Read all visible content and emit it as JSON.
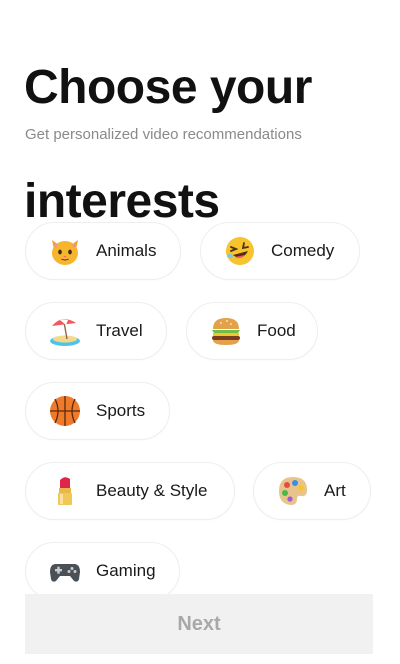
{
  "header": {
    "title_line1": "Choose your",
    "title_line2": "interests",
    "subtitle": "Get personalized video recommendations"
  },
  "interests": [
    {
      "label": "Animals",
      "icon": "cat-face-icon"
    },
    {
      "label": "Comedy",
      "icon": "laughing-face-icon"
    },
    {
      "label": "Travel",
      "icon": "beach-umbrella-icon"
    },
    {
      "label": "Food",
      "icon": "hamburger-icon"
    },
    {
      "label": "Sports",
      "icon": "basketball-icon"
    },
    {
      "label": "Beauty & Style",
      "icon": "lipstick-icon"
    },
    {
      "label": "Art",
      "icon": "palette-icon"
    },
    {
      "label": "Gaming",
      "icon": "game-controller-icon"
    }
  ],
  "footer": {
    "next_label": "Next",
    "next_enabled": false
  },
  "colors": {
    "title": "#111111",
    "subtitle": "#8a8a8a",
    "chip_border": "#eeeeee",
    "button_bg": "#f1f1f2",
    "button_text_disabled": "#a8a8aa"
  }
}
